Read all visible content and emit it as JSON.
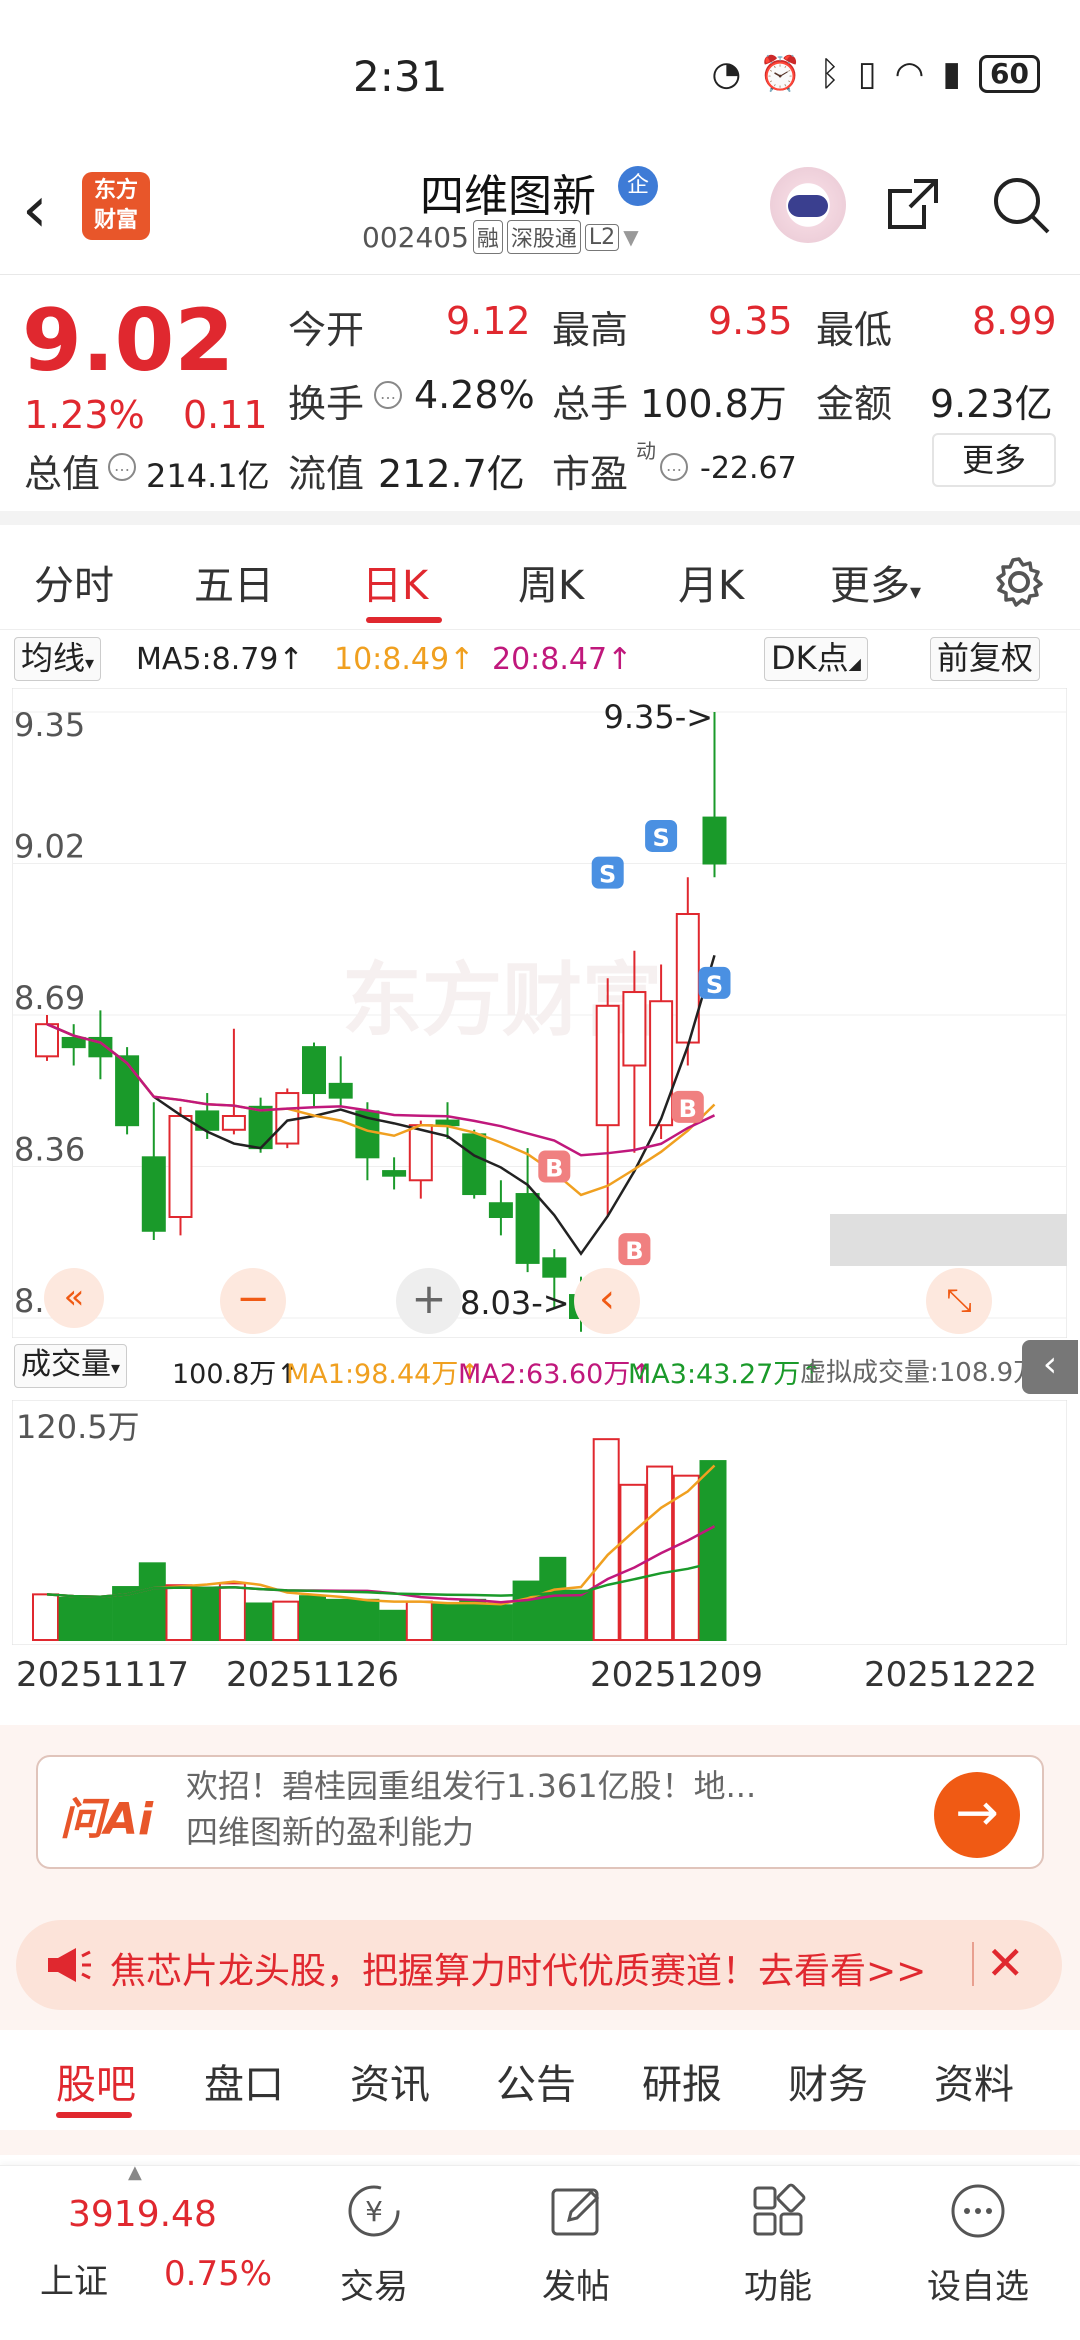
{
  "status_bar": {
    "time": "2:31",
    "battery": "60"
  },
  "header": {
    "logo_line1": "东方",
    "logo_line2": "财富",
    "stock_name": "四维图新",
    "qiye_badge": "企",
    "stock_code": "002405",
    "tags": [
      "融",
      "深股通",
      "L2"
    ]
  },
  "quote": {
    "price": "9.02",
    "change_pct": "1.23%",
    "change": "0.11",
    "open_label": "今开",
    "open": "9.12",
    "high_label": "最高",
    "high": "9.35",
    "low_label": "最低",
    "low": "8.99",
    "turnover_label": "换手",
    "turnover": "4.28%",
    "volume_label": "总手",
    "volume": "100.8万",
    "amount_label": "金额",
    "amount": "9.23亿",
    "total_value_label": "总值",
    "total_value": "214.1亿",
    "float_value_label": "流值",
    "float_value": "212.7亿",
    "pe_label": "市盈",
    "pe_super": "动",
    "pe": "-22.67",
    "more": "更多"
  },
  "tabs": [
    "分时",
    "五日",
    "日K",
    "周K",
    "月K",
    "更多"
  ],
  "ma_bar": {
    "selector": "均线",
    "ma5": "MA5:8.79",
    "ma10": "10:8.49",
    "ma20": "20:8.47",
    "dk": "DK点",
    "fuquan": "前复权"
  },
  "chart_labels": {
    "y_ticks": [
      "9.35",
      "9.02",
      "8.69",
      "8.36",
      "8.03"
    ],
    "high_marker": "9.35->",
    "low_marker": "8.03->",
    "watermark": "东方财富"
  },
  "volume_bar": {
    "selector": "成交量",
    "vol": "100.8万",
    "ma1": "MA1:98.44万",
    "ma2": "MA2:63.60万",
    "ma3": "MA3:43.27万",
    "virtual": "虚拟成交量:108.9万",
    "max_label": "120.5万"
  },
  "dates": [
    "20251117",
    "20251126",
    "20251209",
    "20251222"
  ],
  "ai": {
    "logo": "问Ai",
    "line1": "欢招！碧桂园重组发行1.361亿股！地...",
    "line2": "四维图新的盈利能力"
  },
  "banner": {
    "text": "焦芯片龙头股，把握算力时代优质赛道！去看看>>"
  },
  "bottom_tabs": [
    "股吧",
    "盘口",
    "资讯",
    "公告",
    "研报",
    "财务",
    "资料"
  ],
  "nav": {
    "index_value": "3919.48",
    "index_name": "上证",
    "index_pct": "0.75%",
    "items": [
      "交易",
      "发帖",
      "功能",
      "设自选"
    ]
  },
  "colors": {
    "up": "#e0282f",
    "down": "#1a9a2a",
    "ma5": "#222222",
    "ma10": "#f0a020",
    "ma20": "#c0187c",
    "accent": "#f05a14"
  },
  "chart_data": {
    "type": "candlestick",
    "ylim": [
      8.03,
      9.35
    ],
    "candles": [
      {
        "o": 8.6,
        "c": 8.67,
        "h": 8.69,
        "l": 8.59,
        "v": 0.25
      },
      {
        "o": 8.64,
        "c": 8.62,
        "h": 8.67,
        "l": 8.58,
        "v": 0.23
      },
      {
        "o": 8.64,
        "c": 8.6,
        "h": 8.7,
        "l": 8.55,
        "v": 0.23
      },
      {
        "o": 8.6,
        "c": 8.45,
        "h": 8.62,
        "l": 8.43,
        "v": 0.29
      },
      {
        "o": 8.38,
        "c": 8.22,
        "h": 8.5,
        "l": 8.2,
        "v": 0.42
      },
      {
        "o": 8.25,
        "c": 8.47,
        "h": 8.49,
        "l": 8.21,
        "v": 0.3
      },
      {
        "o": 8.48,
        "c": 8.44,
        "h": 8.52,
        "l": 8.42,
        "v": 0.28
      },
      {
        "o": 8.44,
        "c": 8.47,
        "h": 8.66,
        "l": 8.43,
        "v": 0.31
      },
      {
        "o": 8.49,
        "c": 8.4,
        "h": 8.51,
        "l": 8.39,
        "v": 0.2
      },
      {
        "o": 8.41,
        "c": 8.52,
        "h": 8.53,
        "l": 8.4,
        "v": 0.21
      },
      {
        "o": 8.62,
        "c": 8.52,
        "h": 8.63,
        "l": 8.49,
        "v": 0.24
      },
      {
        "o": 8.54,
        "c": 8.51,
        "h": 8.6,
        "l": 8.49,
        "v": 0.22
      },
      {
        "o": 8.48,
        "c": 8.38,
        "h": 8.5,
        "l": 8.33,
        "v": 0.22
      },
      {
        "o": 8.35,
        "c": 8.34,
        "h": 8.38,
        "l": 8.31,
        "v": 0.16
      },
      {
        "o": 8.33,
        "c": 8.45,
        "h": 8.46,
        "l": 8.29,
        "v": 0.21
      },
      {
        "o": 8.46,
        "c": 8.45,
        "h": 8.5,
        "l": 8.42,
        "v": 0.2
      },
      {
        "o": 8.43,
        "c": 8.3,
        "h": 8.44,
        "l": 8.29,
        "v": 0.22
      },
      {
        "o": 8.28,
        "c": 8.25,
        "h": 8.33,
        "l": 8.21,
        "v": 0.19
      },
      {
        "o": 8.3,
        "c": 8.15,
        "h": 8.4,
        "l": 8.13,
        "v": 0.32
      },
      {
        "o": 8.16,
        "c": 8.12,
        "h": 8.18,
        "l": 8.05,
        "v": 0.45
      },
      {
        "o": 8.08,
        "c": 8.03,
        "h": 8.12,
        "l": 8.0,
        "v": 0.27
      },
      {
        "o": 8.45,
        "c": 8.71,
        "h": 8.77,
        "l": 8.25,
        "v": 1.1
      },
      {
        "o": 8.58,
        "c": 8.74,
        "h": 8.83,
        "l": 8.39,
        "v": 0.85
      },
      {
        "o": 8.45,
        "c": 8.72,
        "h": 8.8,
        "l": 8.42,
        "v": 0.95
      },
      {
        "o": 8.63,
        "c": 8.91,
        "h": 8.99,
        "l": 8.58,
        "v": 0.9
      },
      {
        "o": 9.12,
        "c": 9.02,
        "h": 9.35,
        "l": 8.99,
        "v": 0.98
      }
    ]
  }
}
